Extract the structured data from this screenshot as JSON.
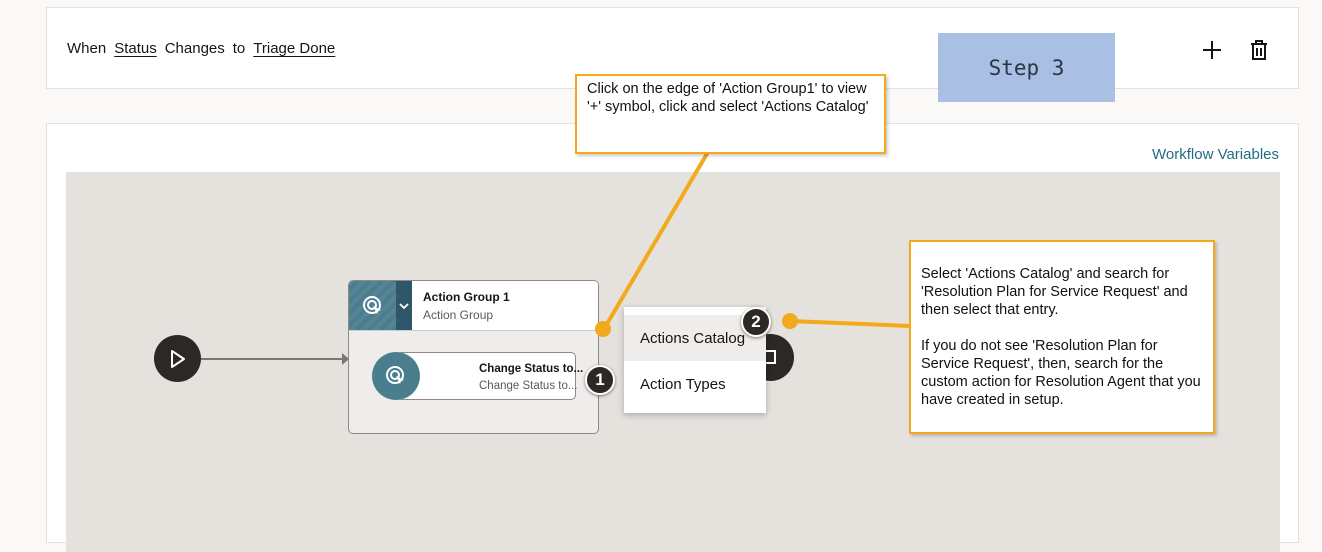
{
  "trigger": {
    "when": "When",
    "field": "Status",
    "changes": "Changes",
    "to": "to",
    "value": "Triage Done"
  },
  "toolbar": {
    "add_icon": "plus-icon",
    "delete_icon": "trash-icon"
  },
  "step_label": "Step 3",
  "workflow": {
    "variables_link": "Workflow Variables",
    "action_group": {
      "title": "Action Group 1",
      "subtitle": "Action Group"
    },
    "action": {
      "title": "Change Status to...",
      "subtitle": "Change Status to..."
    },
    "menu": {
      "items": [
        "Actions Catalog",
        "Action Types"
      ]
    }
  },
  "badges": [
    "1",
    "2"
  ],
  "callouts": {
    "first": "Click on the edge of 'Action Group1' to view '+' symbol, click and select 'Actions Catalog'",
    "second_p1": "Select 'Actions Catalog' and search for 'Resolution Plan for Service Request' and then select that entry.",
    "second_p2": "If you do not see 'Resolution Plan for Service Request', then, search for the custom action for Resolution Agent that you have created in setup."
  },
  "colors": {
    "callout_accent": "#f2a91b",
    "step_bg": "#a9bfe3",
    "link": "#1f6c83",
    "node_teal": "#4a7d8e"
  }
}
